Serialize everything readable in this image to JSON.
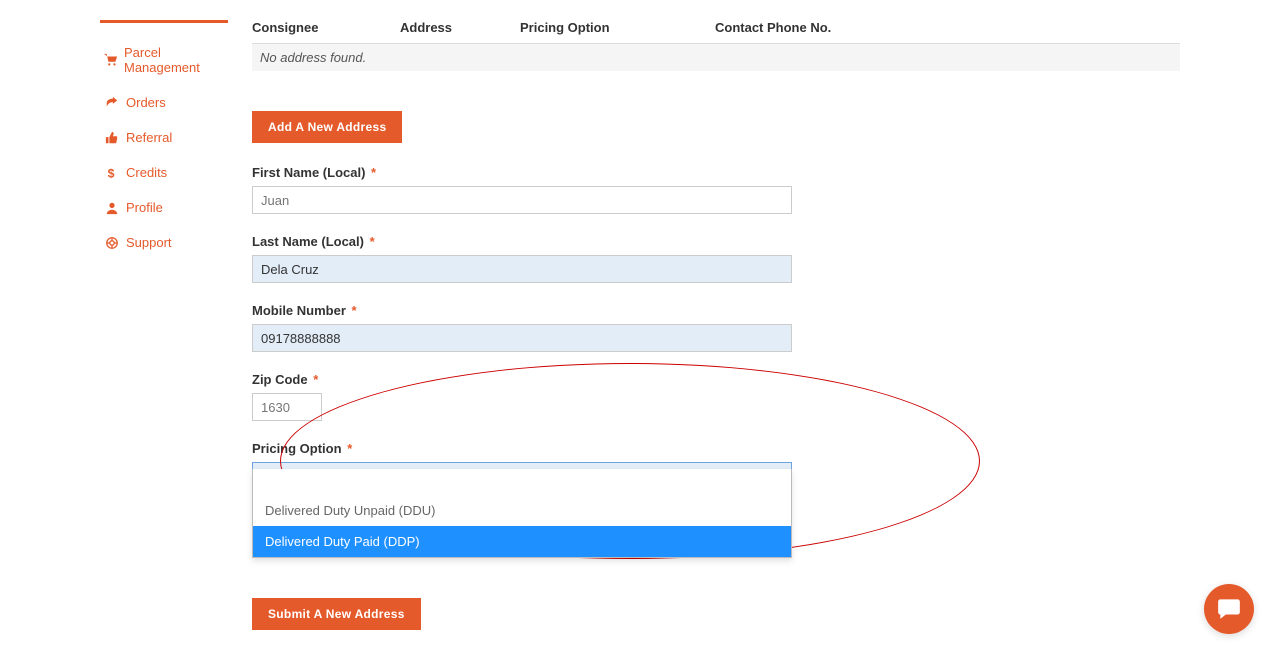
{
  "sidebar": {
    "items": [
      {
        "label": "Parcel Management",
        "icon": "cart-icon"
      },
      {
        "label": "Orders",
        "icon": "share-icon"
      },
      {
        "label": "Referral",
        "icon": "thumbs-up-icon"
      },
      {
        "label": "Credits",
        "icon": "dollar-icon"
      },
      {
        "label": "Profile",
        "icon": "user-icon"
      },
      {
        "label": "Support",
        "icon": "life-ring-icon"
      }
    ]
  },
  "table": {
    "headers": {
      "consignee": "Consignee",
      "address": "Address",
      "pricing": "Pricing Option",
      "phone": "Contact Phone No."
    },
    "empty": "No address found."
  },
  "buttons": {
    "add_address": "Add A New Address",
    "submit_address": "Submit A New Address"
  },
  "form": {
    "first_name": {
      "label": "First Name (Local)",
      "placeholder": "Juan",
      "value": ""
    },
    "last_name": {
      "label": "Last Name (Local)",
      "value": "Dela Cruz"
    },
    "mobile": {
      "label": "Mobile Number",
      "value": "09178888888"
    },
    "zip": {
      "label": "Zip Code",
      "value": "1630"
    },
    "pricing": {
      "label": "Pricing Option",
      "value": "",
      "options": [
        "",
        "Delivered Duty Unpaid (DDU)",
        "Delivered Duty Paid (DDP)"
      ]
    }
  },
  "required_marker": "*"
}
